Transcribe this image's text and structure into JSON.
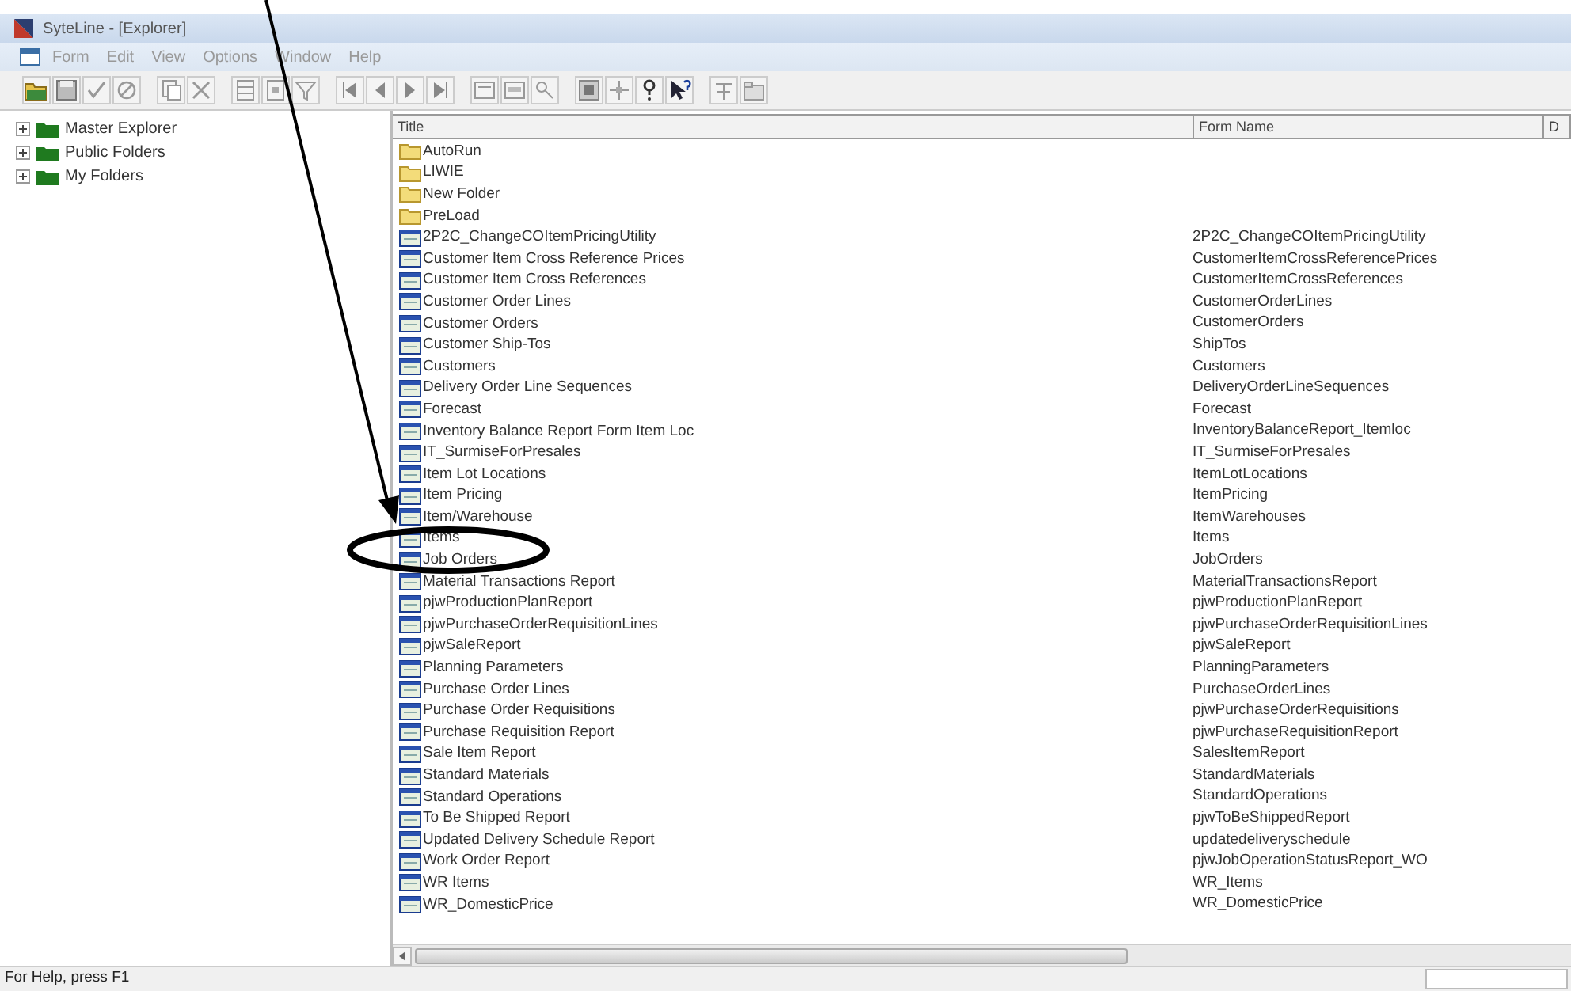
{
  "window": {
    "title": "SyteLine - [Explorer]"
  },
  "menu": [
    "Form",
    "Edit",
    "View",
    "Options",
    "Window",
    "Help"
  ],
  "tree": [
    {
      "label": "Master Explorer",
      "expanded": false
    },
    {
      "label": "Public Folders",
      "expanded": false
    },
    {
      "label": "My Folders",
      "expanded": false
    }
  ],
  "table": {
    "columns": [
      "Title",
      "Form Name",
      "D"
    ],
    "rows": [
      {
        "kind": "folder",
        "title": "AutoRun"
      },
      {
        "kind": "folder",
        "title": "LIWIE"
      },
      {
        "kind": "folder",
        "title": "New Folder"
      },
      {
        "kind": "folder",
        "title": "PreLoad"
      },
      {
        "kind": "form",
        "title": "2P2C_ChangeCOItemPricingUtility",
        "form_name": "2P2C_ChangeCOItemPricingUtility"
      },
      {
        "kind": "form",
        "title": "Customer Item Cross Reference Prices",
        "form_name": "CustomerItemCrossReferencePrices"
      },
      {
        "kind": "form",
        "title": "Customer Item Cross References",
        "form_name": "CustomerItemCrossReferences"
      },
      {
        "kind": "form",
        "title": "Customer Order Lines",
        "form_name": "CustomerOrderLines"
      },
      {
        "kind": "form",
        "title": "Customer Orders",
        "form_name": "CustomerOrders"
      },
      {
        "kind": "form",
        "title": "Customer Ship-Tos",
        "form_name": "ShipTos"
      },
      {
        "kind": "form",
        "title": "Customers",
        "form_name": "Customers"
      },
      {
        "kind": "form",
        "title": "Delivery Order Line Sequences",
        "form_name": "DeliveryOrderLineSequences"
      },
      {
        "kind": "form",
        "title": "Forecast",
        "form_name": "Forecast"
      },
      {
        "kind": "form",
        "title": "Inventory Balance Report Form Item Loc",
        "form_name": "InventoryBalanceReport_Itemloc"
      },
      {
        "kind": "form",
        "title": "IT_SurmiseForPresales",
        "form_name": "IT_SurmiseForPresales"
      },
      {
        "kind": "form",
        "title": "Item Lot Locations",
        "form_name": "ItemLotLocations"
      },
      {
        "kind": "form",
        "title": "Item Pricing",
        "form_name": "ItemPricing"
      },
      {
        "kind": "form",
        "title": "Item/Warehouse",
        "form_name": "ItemWarehouses"
      },
      {
        "kind": "form",
        "title": "Items",
        "form_name": "Items"
      },
      {
        "kind": "form",
        "title": "Job Orders",
        "form_name": "JobOrders"
      },
      {
        "kind": "form",
        "title": "Material Transactions Report",
        "form_name": "MaterialTransactionsReport"
      },
      {
        "kind": "form",
        "title": "pjwProductionPlanReport",
        "form_name": "pjwProductionPlanReport"
      },
      {
        "kind": "form",
        "title": "pjwPurchaseOrderRequisitionLines",
        "form_name": "pjwPurchaseOrderRequisitionLines"
      },
      {
        "kind": "form",
        "title": "pjwSaleReport",
        "form_name": "pjwSaleReport"
      },
      {
        "kind": "form",
        "title": "Planning Parameters",
        "form_name": "PlanningParameters"
      },
      {
        "kind": "form",
        "title": "Purchase Order Lines",
        "form_name": "PurchaseOrderLines"
      },
      {
        "kind": "form",
        "title": "Purchase Order Requisitions",
        "form_name": "pjwPurchaseOrderRequisitions"
      },
      {
        "kind": "form",
        "title": "Purchase Requisition Report",
        "form_name": "pjwPurchaseRequisitionReport"
      },
      {
        "kind": "form",
        "title": "Sale  Item  Report",
        "form_name": "SalesItemReport"
      },
      {
        "kind": "form",
        "title": "Standard Materials",
        "form_name": "StandardMaterials"
      },
      {
        "kind": "form",
        "title": "Standard Operations",
        "form_name": "StandardOperations"
      },
      {
        "kind": "form",
        "title": "To Be Shipped Report",
        "form_name": "pjwToBeShippedReport"
      },
      {
        "kind": "form",
        "title": "Updated Delivery Schedule Report",
        "form_name": "updatedeliveryschedule"
      },
      {
        "kind": "form",
        "title": "Work Order Report",
        "form_name": "pjwJobOperationStatusReport_WO"
      },
      {
        "kind": "form",
        "title": "WR Items",
        "form_name": "WR_Items"
      },
      {
        "kind": "form",
        "title": "WR_DomesticPrice",
        "form_name": "WR_DomesticPrice"
      }
    ]
  },
  "status_bar": {
    "text": "For Help, press F1"
  }
}
